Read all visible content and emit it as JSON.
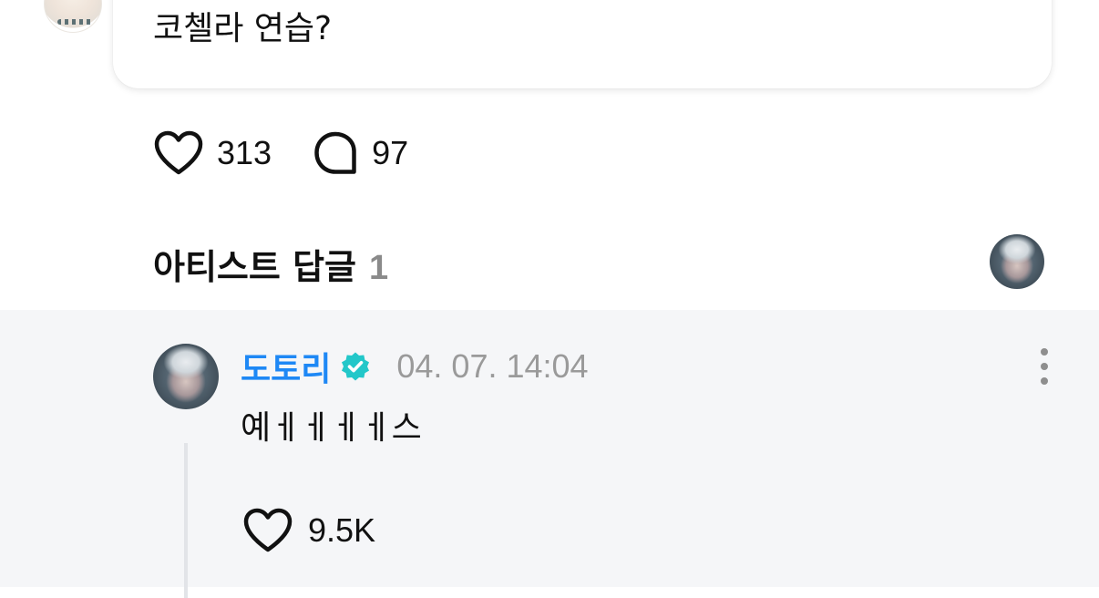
{
  "post": {
    "text": "코첼라 연습?",
    "likes": "313",
    "comments": "97"
  },
  "artist_replies": {
    "title": "아티스트 답글",
    "count": "1"
  },
  "reply": {
    "author": "도토리",
    "verified": true,
    "timestamp": "04. 07. 14:04",
    "text": "예ㅔㅔㅔㅔ스",
    "likes": "9.5K"
  },
  "colors": {
    "author_name": "#1e88f5",
    "verified_badge": "#22c7c9",
    "timestamp": "#9a9a9a",
    "reply_background": "#f5f6f8"
  },
  "icons": {
    "like": "heart-outline-icon",
    "comment": "speech-bubble-icon",
    "verified": "verified-badge-icon",
    "more": "more-vertical-icon"
  }
}
